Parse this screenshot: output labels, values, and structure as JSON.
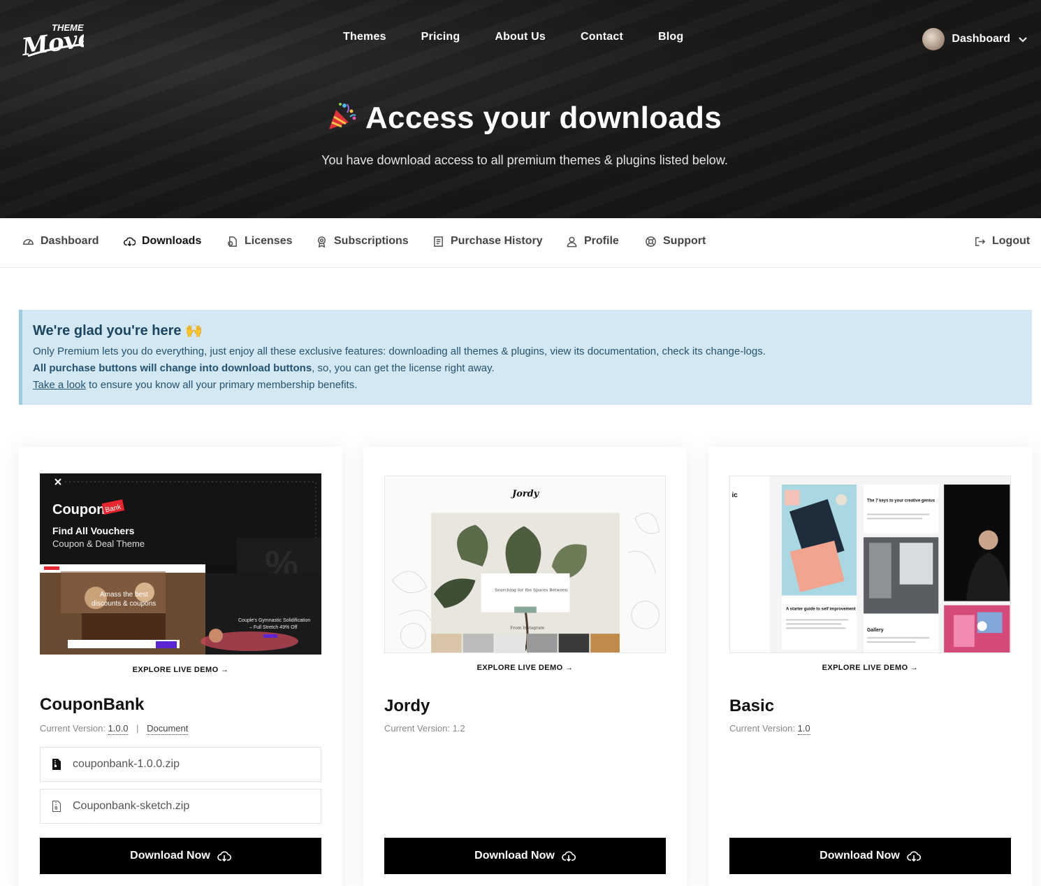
{
  "brand": {
    "logo_text_top": "THEME",
    "logo_text_main": "Move"
  },
  "topnav": [
    "Themes",
    "Pricing",
    "About Us",
    "Contact",
    "Blog"
  ],
  "user": {
    "label": "Dashboard"
  },
  "hero": {
    "title": "Access your downloads",
    "subtitle": "You have download access to all premium themes & plugins listed below."
  },
  "tabs": [
    {
      "label": "Dashboard",
      "icon": "dashboard-icon"
    },
    {
      "label": "Downloads",
      "icon": "cloud-download-icon"
    },
    {
      "label": "Licenses",
      "icon": "license-icon"
    },
    {
      "label": "Subscriptions",
      "icon": "award-icon"
    },
    {
      "label": "Purchase History",
      "icon": "receipt-icon"
    },
    {
      "label": "Profile",
      "icon": "user-icon"
    },
    {
      "label": "Support",
      "icon": "lifebuoy-icon"
    },
    {
      "label": "Logout",
      "icon": "logout-icon"
    }
  ],
  "notice": {
    "title": "We're glad you're here 🙌",
    "line1": "Only Premium lets you do everything, just enjoy all these exclusive features: downloading all themes & plugins, view its documentation, check its change-logs.",
    "line2_bold": "All purchase buttons will change into download buttons",
    "line2_rest": ", so, you can get the license right away.",
    "line3_link": "Take a look",
    "line3_rest": " to ensure you know all your primary membership benefits."
  },
  "explore_label": "EXPLORE LIVE DEMO",
  "version_prefix": "Current Version:",
  "download_label": "Download Now",
  "products": [
    {
      "name": "CouponBank",
      "version": "1.0.0",
      "doc_label": "Document",
      "files": [
        "couponbank-1.0.0.zip",
        "Couponbank-sketch.zip"
      ],
      "thumb": {
        "brand": "Coupon",
        "brand_badge": "Bank",
        "headline": "Find All Vouchers",
        "subline": "Coupon & Deal Theme",
        "promo": "Amass the best discounts & coupons",
        "offer": "Couple's Gymnastic Solidification – Full Stretch 49% Off"
      }
    },
    {
      "name": "Jordy",
      "version": "1.2",
      "thumb": {
        "brand": "Jordy",
        "caption": "Searching for the Spaces Between",
        "section": "From Instagram"
      }
    },
    {
      "name": "Basic",
      "version": "1.0",
      "thumb": {
        "post1": "The 7 keys to your creative genius",
        "post2": "A starter guide to self improvement",
        "post3": "Gallery"
      }
    }
  ],
  "colors": {
    "hero_bg": "#181818",
    "notice_bg": "#d3e8f3",
    "notice_text": "#245272",
    "button_bg": "#000000"
  }
}
